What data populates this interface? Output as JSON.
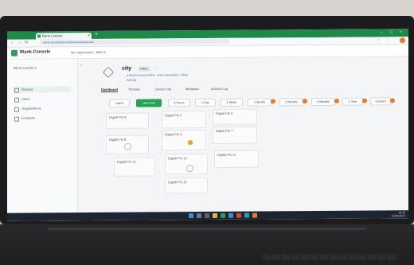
{
  "browser": {
    "tab_title": "Blynk.Console",
    "new_tab": "+",
    "window_controls": "– □ ×",
    "url": "blynk.cloud/dashboard/device/dashboard",
    "extensions": "☆ ⋮"
  },
  "app": {
    "brand": "Blynk.Console",
    "breadcrumb": "My organization - 8684 ▾",
    "org_selector": "Blynk.Console ▾",
    "collapse": "«",
    "sidebar": [
      {
        "label": "Devices",
        "icon": "devices-icon",
        "active": true
      },
      {
        "label": "Users",
        "icon": "users-icon",
        "active": false
      },
      {
        "label": "Organizations",
        "icon": "organizations-icon",
        "active": false
      },
      {
        "label": "Locations",
        "icon": "location-icon",
        "active": false
      }
    ]
  },
  "device": {
    "name": "city",
    "badge": "Offline",
    "more": "···",
    "owner": "Blynk.Console Admin",
    "meta2": "My organization - 8684",
    "tag": "Add tag",
    "tabs": [
      "Dashboard",
      "Timeline",
      "Device Info",
      "Metadata",
      "Actions Log"
    ],
    "selected_tab": 0
  },
  "periods": [
    {
      "label": "Latest",
      "active": false
    },
    {
      "label": "Last Hour",
      "active": true
    },
    {
      "label": "6 Hours",
      "active": false
    },
    {
      "label": "1 Day",
      "active": false
    },
    {
      "label": "1 Week",
      "active": false
    },
    {
      "label": "1 Month",
      "active": false
    },
    {
      "label": "3 Months",
      "active": false
    },
    {
      "label": "6 Months",
      "active": false
    },
    {
      "label": "1 Year",
      "active": false
    },
    {
      "label": "Custom",
      "active": false
    }
  ],
  "tiles": [
    "Digital Pin 9",
    "Digital Pin 5",
    "Digital Pin 6",
    "Digital Pin 8",
    "Digital Pin 4",
    "Digital Pin 7",
    "Digital Pin 13",
    "Digital Pin 12",
    "Digital Pin 11",
    "Digital Pin 10"
  ],
  "tray": {
    "time": "10:35",
    "date": "12/05/2023"
  },
  "colors": {
    "accent": "#23a455",
    "brand": "#2e9c5a",
    "warning": "#e87a2c",
    "taskbar": "#1d2533"
  }
}
